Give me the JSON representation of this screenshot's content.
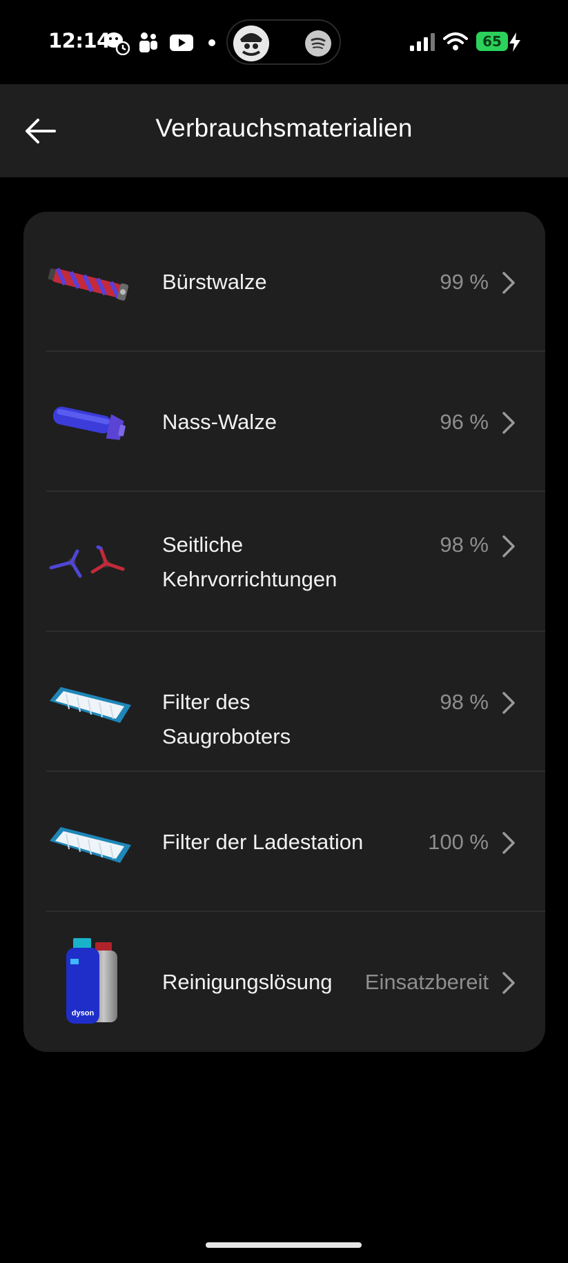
{
  "status_bar": {
    "time": "12:14",
    "battery": "65",
    "icons": [
      "wechat-clock-icon",
      "teams-icon",
      "youtube-icon",
      "dot-icon",
      "spotify-icon",
      "signal-icon",
      "wifi-icon",
      "charging-icon"
    ]
  },
  "header": {
    "title": "Verbrauchsmaterialien",
    "back_icon": "arrow-left-icon"
  },
  "consumables": [
    {
      "label": "Bürstwalze",
      "value": "99 %",
      "icon": "brush-roller-icon"
    },
    {
      "label": "Nass-Walze",
      "value": "96 %",
      "icon": "wet-roller-icon"
    },
    {
      "label": "Seitliche Kehrvorrichtungen",
      "value": "98 %",
      "icon": "side-brushes-icon"
    },
    {
      "label": "Filter des Saugroboters",
      "value": "98 %",
      "icon": "robot-filter-icon"
    },
    {
      "label": "Filter der Ladestation",
      "value": "100 %",
      "icon": "station-filter-icon"
    },
    {
      "label": "Reinigungslösung",
      "value": "Einsatzbereit",
      "icon": "cleaning-solution-icon",
      "bottle_brand": "dyson"
    }
  ],
  "colors": {
    "background": "#000000",
    "surface": "#1f1f1f",
    "value_text": "#8e8e8e",
    "battery": "#2bd15a"
  }
}
